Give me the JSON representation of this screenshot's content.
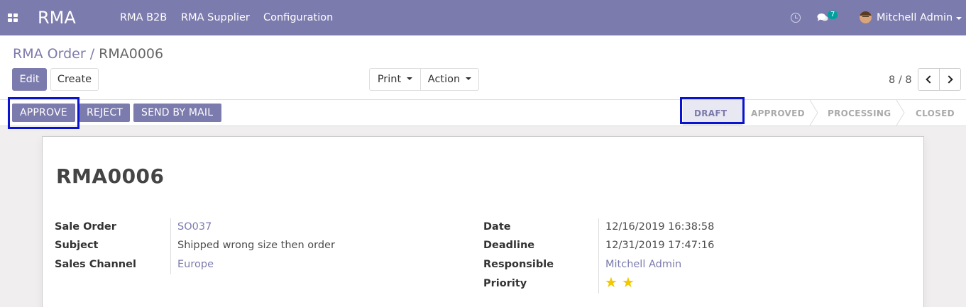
{
  "navbar": {
    "brand": "RMA",
    "menu": [
      "RMA B2B",
      "RMA Supplier",
      "Configuration"
    ],
    "chat_count": "7",
    "user_name": "Mitchell Admin"
  },
  "breadcrumb": {
    "parent": "RMA Order",
    "separator": "/",
    "current": "RMA0006"
  },
  "toolbar": {
    "edit": "Edit",
    "create": "Create",
    "print": "Print",
    "action": "Action"
  },
  "pager": {
    "value": "8 / 8"
  },
  "statusbar": {
    "buttons": [
      "APPROVE",
      "REJECT",
      "SEND BY MAIL"
    ],
    "stages": [
      "DRAFT",
      "APPROVED",
      "PROCESSING",
      "CLOSED"
    ],
    "active_stage": "DRAFT"
  },
  "record": {
    "name": "RMA0006",
    "left_fields": [
      {
        "label": "Sale Order",
        "value": "SO037"
      },
      {
        "label": "Subject",
        "value": "Shipped wrong size then order"
      },
      {
        "label": "Sales Channel",
        "value": "Europe"
      }
    ],
    "right_fields": [
      {
        "label": "Date",
        "value": "12/16/2019 16:38:58"
      },
      {
        "label": "Deadline",
        "value": "12/31/2019 17:47:16"
      },
      {
        "label": "Responsible",
        "value": "Mitchell Admin"
      },
      {
        "label": "Priority",
        "value": "2"
      }
    ]
  },
  "colors": {
    "brand": "#7c7bad",
    "highlight": "#0a14d0",
    "star": "#f3c800",
    "badge": "#00a09d"
  }
}
